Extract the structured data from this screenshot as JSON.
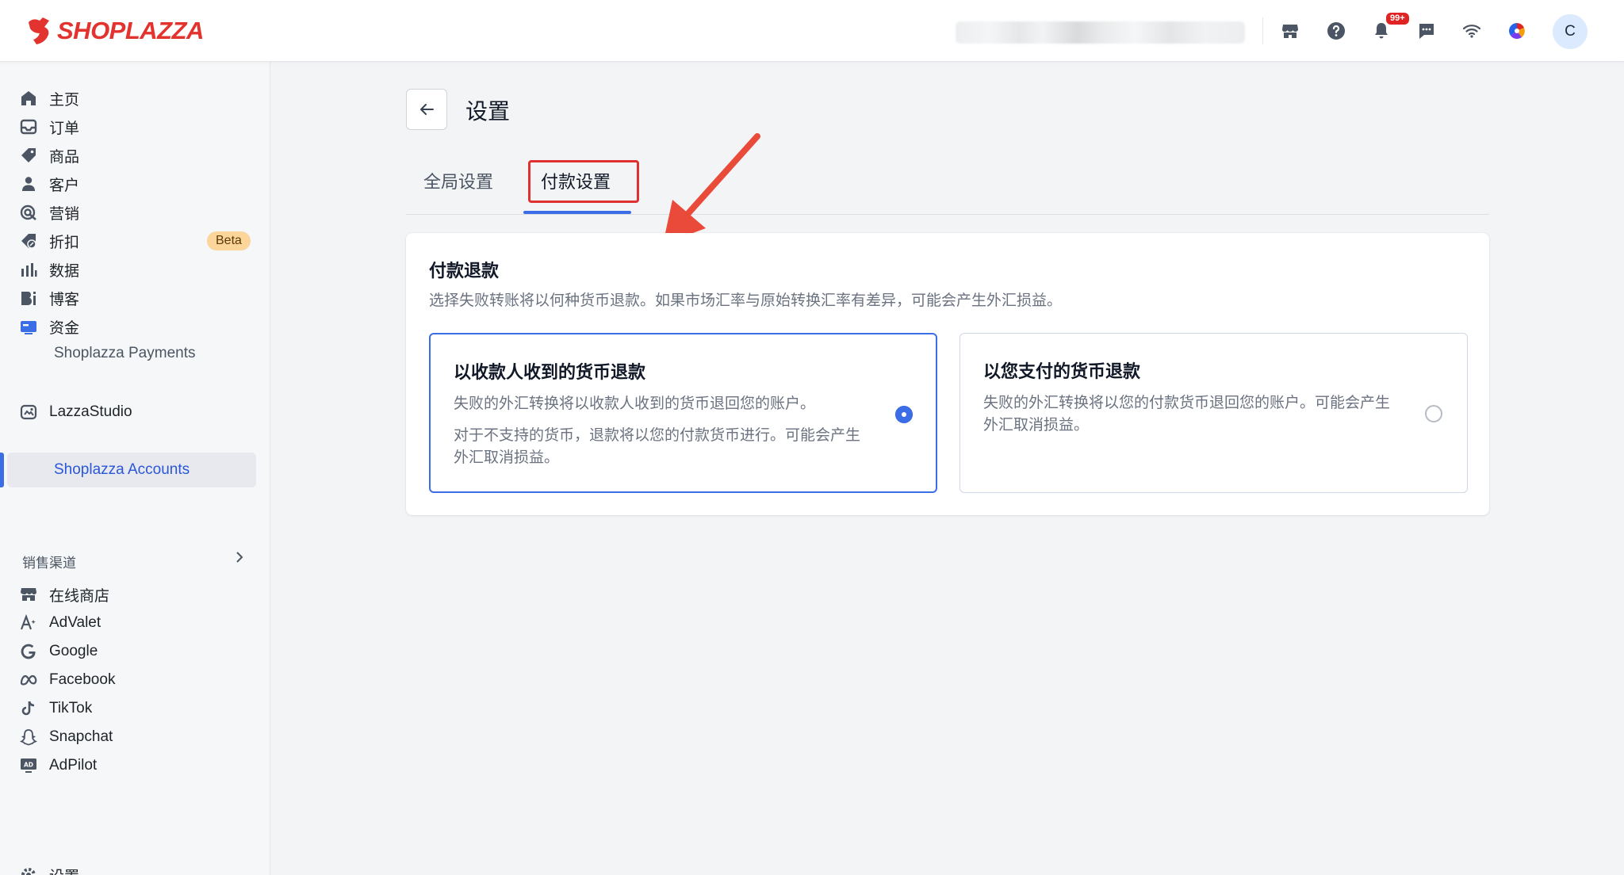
{
  "brand": {
    "name": "SHOPLAZZA",
    "color": "#e2332f"
  },
  "topbar": {
    "notification_badge": "99+",
    "avatar_letter": "C",
    "icons": [
      "store-icon",
      "help-icon",
      "bell-icon",
      "message-icon",
      "wifi-icon",
      "color-wheel-icon"
    ]
  },
  "sidebar": {
    "items": [
      {
        "label": "主页",
        "icon": "home-icon"
      },
      {
        "label": "订单",
        "icon": "inbox-icon"
      },
      {
        "label": "商品",
        "icon": "tag-icon"
      },
      {
        "label": "客户",
        "icon": "person-icon"
      },
      {
        "label": "营销",
        "icon": "target-icon"
      },
      {
        "label": "折扣",
        "icon": "discount-icon",
        "badge": "Beta"
      },
      {
        "label": "数据",
        "icon": "bar-chart-icon"
      },
      {
        "label": "博客",
        "icon": "blog-icon"
      },
      {
        "label": "资金",
        "icon": "wallet-icon"
      }
    ],
    "sub_items": [
      {
        "label": "Shoplazza Payments"
      },
      {
        "label": "Shoplazza Accounts"
      }
    ],
    "lazza_studio": "LazzaStudio",
    "sales_channels_label": "销售渠道",
    "channels": [
      {
        "label": "在线商店",
        "icon": "store-icon"
      },
      {
        "label": "AdValet",
        "icon": "ad-icon"
      },
      {
        "label": "Google",
        "icon": "google-icon"
      },
      {
        "label": "Facebook",
        "icon": "meta-icon"
      },
      {
        "label": "TikTok",
        "icon": "tiktok-icon"
      },
      {
        "label": "Snapchat",
        "icon": "snapchat-icon"
      },
      {
        "label": "AdPilot",
        "icon": "adpilot-icon"
      }
    ],
    "settings_label": "设置"
  },
  "page": {
    "title": "设置",
    "tabs": [
      {
        "label": "全局设置"
      },
      {
        "label": "付款设置"
      }
    ]
  },
  "card": {
    "title": "付款退款",
    "description": "选择失败转账将以何种货币退款。如果市场汇率与原始转换汇率有差异，可能会产生外汇损益。",
    "options": [
      {
        "title": "以收款人收到的货币退款",
        "line1": "失败的外汇转换将以收款人收到的货币退回您的账户。",
        "line2": "对于不支持的货币，退款将以您的付款货币进行。可能会产生外汇取消损益。",
        "selected": true
      },
      {
        "title": "以您支付的货币退款",
        "line1": "失败的外汇转换将以您的付款货币退回您的账户。可能会产生外汇取消损益。",
        "selected": false
      }
    ]
  },
  "colors": {
    "accent": "#3b6ee6",
    "highlight_red": "#e03131",
    "beta_badge": "#fbd59a"
  }
}
